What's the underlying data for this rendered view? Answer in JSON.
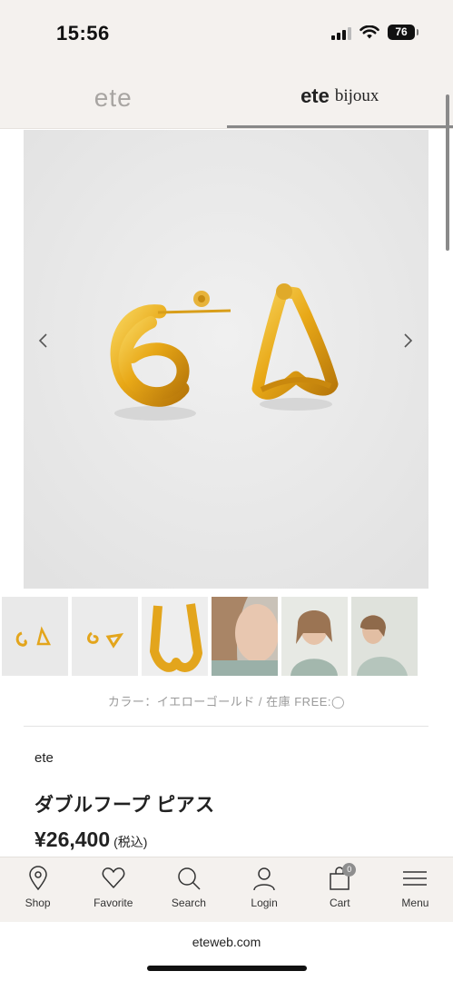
{
  "status_bar": {
    "time": "15:56",
    "battery": "76"
  },
  "brand_tabs": [
    {
      "label": "ete"
    },
    {
      "label_main": "ete",
      "label_sub": "bijoux"
    }
  ],
  "gallery": {
    "prev_icon": "chevron-left-icon",
    "next_icon": "chevron-right-icon",
    "thumbnails": [
      "earrings-flat-1",
      "earrings-flat-2",
      "earring-closeup",
      "model-1",
      "model-2",
      "model-3"
    ]
  },
  "product": {
    "availability": "カラー：イエローゴールド / 在庫 FREE:◯",
    "brand": "ete",
    "name": "ダブルフープ ピアス",
    "price": "¥26,400",
    "tax_note": "(税込)"
  },
  "bottom_nav": [
    {
      "label": "Shop",
      "icon": "map-pin-icon"
    },
    {
      "label": "Favorite",
      "icon": "heart-icon"
    },
    {
      "label": "Search",
      "icon": "search-icon"
    },
    {
      "label": "Login",
      "icon": "person-icon"
    },
    {
      "label": "Cart",
      "icon": "shopping-bag-icon",
      "badge": "0"
    },
    {
      "label": "Menu",
      "icon": "hamburger-menu-icon"
    }
  ],
  "browser": {
    "url": "eteweb.com"
  },
  "colors": {
    "chrome_bg": "#f4f1ee",
    "gold": "#e3a51c",
    "text": "#222222"
  }
}
